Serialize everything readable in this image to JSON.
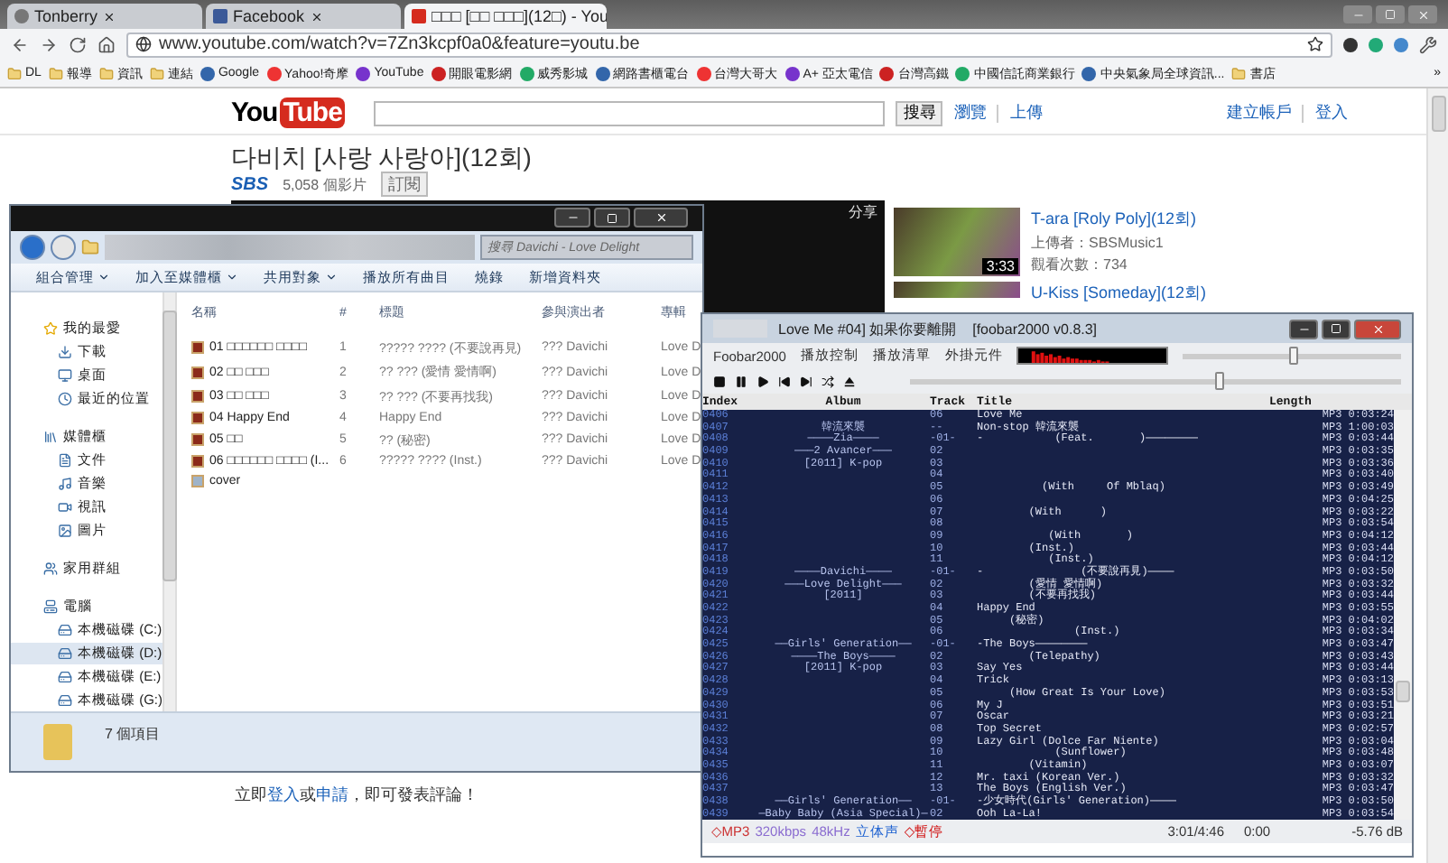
{
  "browser": {
    "tabs": [
      {
        "label": "Tonberry",
        "selected": false
      },
      {
        "label": "Facebook",
        "selected": false
      },
      {
        "label": "□□□ [□□ □□□](12□) - You",
        "selected": true
      }
    ],
    "url": "www.youtube.com/watch?v=7Zn3kcpf0a0&feature=youtu.be",
    "bookmarks": [
      {
        "label": "DL",
        "kind": "folder"
      },
      {
        "label": "報導",
        "kind": "folder"
      },
      {
        "label": "資訊",
        "kind": "folder"
      },
      {
        "label": "連結",
        "kind": "folder"
      },
      {
        "label": "Google",
        "kind": "site"
      },
      {
        "label": "Yahoo!奇摩",
        "kind": "site"
      },
      {
        "label": "YouTube",
        "kind": "site"
      },
      {
        "label": "開眼電影網",
        "kind": "site"
      },
      {
        "label": "威秀影城",
        "kind": "site"
      },
      {
        "label": "網路書櫃電台",
        "kind": "site"
      },
      {
        "label": "台灣大哥大",
        "kind": "site"
      },
      {
        "label": "A+ 亞太電信",
        "kind": "site"
      },
      {
        "label": "台灣高鐵",
        "kind": "site"
      },
      {
        "label": "中國信託商業銀行",
        "kind": "site"
      },
      {
        "label": "中央氣象局全球資訊...",
        "kind": "site"
      },
      {
        "label": "書店",
        "kind": "folder"
      }
    ],
    "more": "»"
  },
  "youtube": {
    "logo": {
      "left": "You",
      "right": "Tube"
    },
    "search_button": "搜尋",
    "nav_links": [
      "瀏覽",
      "上傳"
    ],
    "account_links": [
      "建立帳戶",
      "登入"
    ],
    "video_title": "다비치 [사랑 사랑아](12회)",
    "channel": {
      "logo": "SBS",
      "count": "5,058 個影片",
      "subscribe": "訂閱"
    },
    "share": "分享",
    "related": [
      {
        "title": "T-ara [Roly Poly](12회)",
        "uploader": "上傳者：SBSMusic1",
        "views": "觀看次數：734",
        "duration": "3:33"
      },
      {
        "title": "U-Kiss [Someday](12회)"
      }
    ],
    "comment_prompt": [
      {
        "kind": "text",
        "text": "立即"
      },
      {
        "kind": "link",
        "text": "登入"
      },
      {
        "kind": "text",
        "text": "或"
      },
      {
        "kind": "link",
        "text": "申請"
      },
      {
        "kind": "text",
        "text": "，即可發表評論！"
      }
    ]
  },
  "explorer": {
    "search_placeholder": "搜尋 Davichi - Love Delight",
    "toolbar": [
      {
        "label": "組合管理",
        "menu": true
      },
      {
        "label": "加入至媒體櫃",
        "menu": true
      },
      {
        "label": "共用對象",
        "menu": true
      },
      {
        "label": "播放所有曲目",
        "menu": false
      },
      {
        "label": "燒錄",
        "menu": false
      },
      {
        "label": "新增資料夾",
        "menu": false
      }
    ],
    "nav": [
      {
        "label": "我的最愛",
        "selected": false,
        "children": [
          {
            "label": "下載",
            "selected": false
          },
          {
            "label": "桌面",
            "selected": false
          },
          {
            "label": "最近的位置",
            "selected": false
          }
        ]
      },
      {
        "label": "媒體櫃",
        "selected": false,
        "children": [
          {
            "label": "文件",
            "selected": false
          },
          {
            "label": "音樂",
            "selected": false
          },
          {
            "label": "視訊",
            "selected": false
          },
          {
            "label": "圖片",
            "selected": false
          }
        ]
      },
      {
        "label": "家用群組",
        "selected": false
      },
      {
        "label": "電腦",
        "selected": false,
        "children": [
          {
            "label": "本機磁碟 (C:)",
            "selected": false
          },
          {
            "label": "本機磁碟 (D:)",
            "selected": true
          },
          {
            "label": "本機磁碟 (E:)",
            "selected": false
          },
          {
            "label": "本機磁碟 (G:)",
            "selected": false
          }
        ]
      }
    ],
    "columns": [
      "名稱",
      "#",
      "標題",
      "參與演出者",
      "專輯"
    ],
    "files": [
      {
        "kind": "audio",
        "name": "01 □□□□□□ □□□□",
        "number": "1",
        "title": "????? ???? (不要說再見)",
        "artist": "??? Davichi",
        "album": "Love D"
      },
      {
        "kind": "audio",
        "name": "02 □□ □□□",
        "number": "2",
        "title": "?? ??? (愛情 愛情啊)",
        "artist": "??? Davichi",
        "album": "Love D"
      },
      {
        "kind": "audio",
        "name": "03 □□ □□□",
        "number": "3",
        "title": "?? ??? (不要再找我)",
        "artist": "??? Davichi",
        "album": "Love D"
      },
      {
        "kind": "audio",
        "name": "04 Happy End",
        "number": "4",
        "title": "Happy End",
        "artist": "??? Davichi",
        "album": "Love D"
      },
      {
        "kind": "audio",
        "name": "05 □□",
        "number": "5",
        "title": "?? (秘密)",
        "artist": "??? Davichi",
        "album": "Love D"
      },
      {
        "kind": "audio",
        "name": "06 □□□□□□ □□□□ (I...",
        "number": "6",
        "title": "????? ???? (Inst.)",
        "artist": "??? Davichi",
        "album": "Love D"
      },
      {
        "kind": "image",
        "name": "cover"
      }
    ],
    "status": "7 個項目"
  },
  "foobar": {
    "title": "Love Me #04] 如果你要離開    [foobar2000 v0.8.3]",
    "menu": [
      "Foobar2000",
      "播放控制",
      "播放清單",
      "外掛元件"
    ],
    "volume": {
      "level": 0.5
    },
    "seek": {
      "level": 0.63
    },
    "columns": [
      "Index",
      "Album",
      "Track",
      "Title",
      "Length"
    ],
    "rows": [
      {
        "index": "0406",
        "track": "06",
        "title": "Love Me",
        "length": "MP3 0:03:24"
      },
      {
        "index": "0407",
        "album": "韓流來襲",
        "track": "--",
        "title": "Non-stop 韓流來襲",
        "length": "MP3 1:00:03"
      },
      {
        "index": "0408",
        "album": "————Zia————",
        "track": "-01-",
        "title": "-           (Feat.       )————————",
        "length": "MP3 0:03:44"
      },
      {
        "index": "0409",
        "album": "———2 Avancer———",
        "track": "02",
        "length": "MP3 0:03:35"
      },
      {
        "index": "0410",
        "album": "[2011] K-pop",
        "track": "03",
        "length": "MP3 0:03:36"
      },
      {
        "index": "0411",
        "track": "04",
        "length": "MP3 0:03:40"
      },
      {
        "index": "0412",
        "track": "05",
        "title": "          (With     Of Mblaq)",
        "length": "MP3 0:03:49"
      },
      {
        "index": "0413",
        "track": "06",
        "length": "MP3 0:04:25"
      },
      {
        "index": "0414",
        "track": "07",
        "title": "        (With      )",
        "length": "MP3 0:03:22"
      },
      {
        "index": "0415",
        "track": "08",
        "length": "MP3 0:03:54"
      },
      {
        "index": "0416",
        "track": "09",
        "title": "           (With       )",
        "length": "MP3 0:04:12"
      },
      {
        "index": "0417",
        "track": "10",
        "title": "        (Inst.)",
        "length": "MP3 0:03:44"
      },
      {
        "index": "0418",
        "track": "11",
        "title": "           (Inst.)",
        "length": "MP3 0:04:12"
      },
      {
        "index": "0419",
        "album": "————Davichi————",
        "track": "-01-",
        "title": "-               (不要說再見)————",
        "length": "MP3 0:03:50"
      },
      {
        "index": "0420",
        "album": "———Love Delight———",
        "track": "02",
        "title": "        (愛情 愛情啊)",
        "length": "MP3 0:03:32"
      },
      {
        "index": "0421",
        "album": "[2011]",
        "track": "03",
        "title": "        (不要再找我)",
        "length": "MP3 0:03:44"
      },
      {
        "index": "0422",
        "track": "04",
        "title": "Happy End",
        "length": "MP3 0:03:55"
      },
      {
        "index": "0423",
        "track": "05",
        "title": "     (秘密)",
        "length": "MP3 0:04:02"
      },
      {
        "index": "0424",
        "track": "06",
        "title": "               (Inst.)",
        "length": "MP3 0:03:34"
      },
      {
        "index": "0425",
        "album": "——Girls' Generation——",
        "track": "-01-",
        "title": "-The Boys————————",
        "length": "MP3 0:03:47"
      },
      {
        "index": "0426",
        "album": "————The Boys————",
        "track": "02",
        "title": "        (Telepathy)",
        "length": "MP3 0:03:43"
      },
      {
        "index": "0427",
        "album": "[2011] K-pop",
        "track": "03",
        "title": "Say Yes",
        "length": "MP3 0:03:44"
      },
      {
        "index": "0428",
        "track": "04",
        "title": "Trick",
        "length": "MP3 0:03:13"
      },
      {
        "index": "0429",
        "track": "05",
        "title": "     (How Great Is Your Love)",
        "length": "MP3 0:03:53"
      },
      {
        "index": "0430",
        "track": "06",
        "title": "My J",
        "length": "MP3 0:03:51"
      },
      {
        "index": "0431",
        "track": "07",
        "title": "Oscar",
        "length": "MP3 0:03:21"
      },
      {
        "index": "0432",
        "track": "08",
        "title": "Top Secret",
        "length": "MP3 0:02:57"
      },
      {
        "index": "0433",
        "track": "09",
        "title": "Lazy Girl (Dolce Far Niente)",
        "length": "MP3 0:03:04"
      },
      {
        "index": "0434",
        "track": "10",
        "title": "            (Sunflower)",
        "length": "MP3 0:03:48"
      },
      {
        "index": "0435",
        "track": "11",
        "title": "        (Vitamin)",
        "length": "MP3 0:03:07"
      },
      {
        "index": "0436",
        "track": "12",
        "title": "Mr. taxi (Korean Ver.)",
        "length": "MP3 0:03:32"
      },
      {
        "index": "0437",
        "track": "13",
        "title": "The Boys (English Ver.)",
        "length": "MP3 0:03:47"
      },
      {
        "index": "0438",
        "album": "——Girls' Generation——",
        "track": "-01-",
        "title": "-少女時代(Girls' Generation)————",
        "length": "MP3 0:03:50"
      },
      {
        "index": "0439",
        "album": "—Baby Baby (Asia Special)—",
        "track": "02",
        "title": "Ooh La-La!",
        "length": "MP3 0:03:54"
      }
    ],
    "status": {
      "codec": "◇MP3",
      "bitrate": "320kbps",
      "rate": "48kHz",
      "channels": "立体声",
      "state": "◇暫停",
      "time": "3:01/4:46",
      "elapsed": "0:00",
      "gain": "-5.76 dB"
    }
  }
}
